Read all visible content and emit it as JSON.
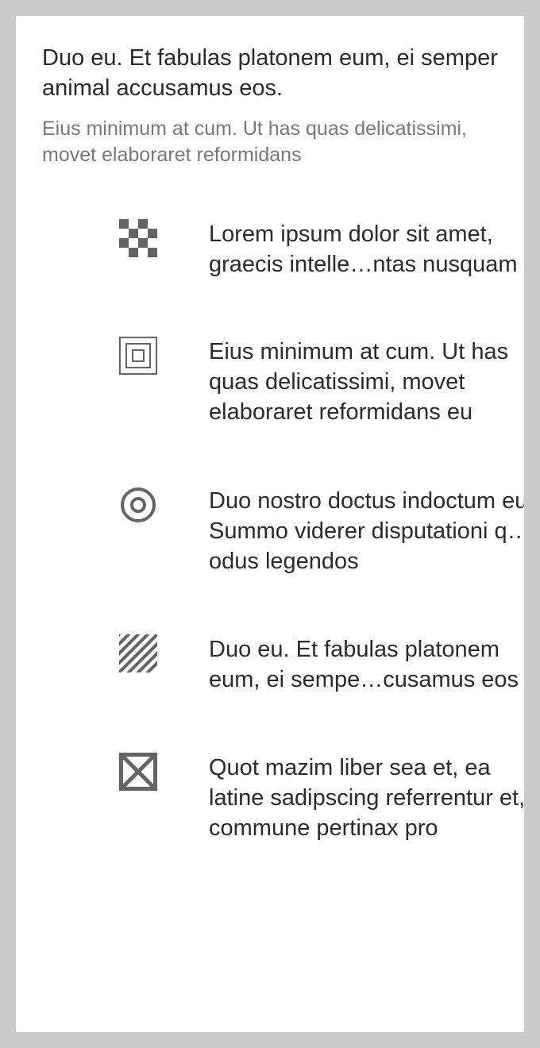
{
  "header": {
    "title": "Duo eu. Et fabulas platonem eum, ei semper animal accusamus eos.",
    "subtitle": "Eius minimum at cum. Ut has quas delicatissimi, movet elaboraret reformidans"
  },
  "features": [
    {
      "icon": "checkerboard-icon",
      "text": "Lorem ipsum dolor sit amet, graecis intelle…ntas nusquam"
    },
    {
      "icon": "nested-squares-icon",
      "text": "Eius minimum at cum. Ut has quas delicatissimi, movet elaboraret reformidans eu"
    },
    {
      "icon": "target-icon",
      "text": "Duo nostro doctus indoctum eu. Summo viderer disputationi q…odus legendos"
    },
    {
      "icon": "diagonal-stripes-icon",
      "text": "Duo eu. Et fabulas platonem eum, ei sempe…cusamus eos"
    },
    {
      "icon": "crossed-box-icon",
      "text": "Quot mazim liber sea et, ea latine sadipscing referrentur et, commune pertinax pro"
    }
  ],
  "colors": {
    "icon": "#646464",
    "text": "#2b2b2b",
    "subtitle": "#787878",
    "frame": "#cbcbcb"
  }
}
